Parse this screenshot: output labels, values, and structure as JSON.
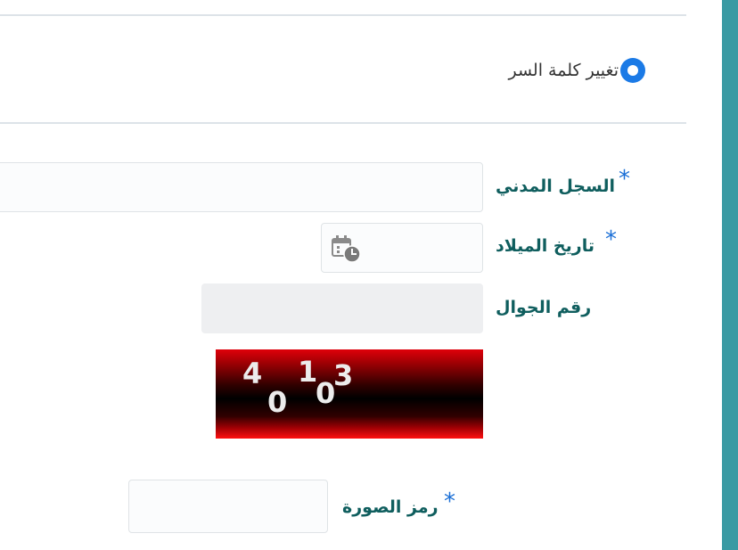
{
  "change_password": {
    "label": "تغيير كلمة السر",
    "selected": true
  },
  "form": {
    "civil_id": {
      "label": "السجل المدني",
      "required_mark": "*",
      "value": ""
    },
    "birth_date": {
      "label": "تاريخ الميلاد",
      "required_mark": "*",
      "value": "",
      "icon": "calendar-clock-icon"
    },
    "mobile": {
      "label": "رقم الجوال",
      "value": ""
    },
    "captcha": {
      "characters": [
        "4",
        "0",
        "1",
        "0",
        "3"
      ]
    },
    "image_code": {
      "label": "رمز الصورة",
      "required_mark": "*",
      "value": ""
    }
  },
  "colors": {
    "accent_bar": "#3a9aa3",
    "label": "#0f5e5e",
    "required": "#1b6fd6",
    "radio": "#1b7ae6"
  }
}
